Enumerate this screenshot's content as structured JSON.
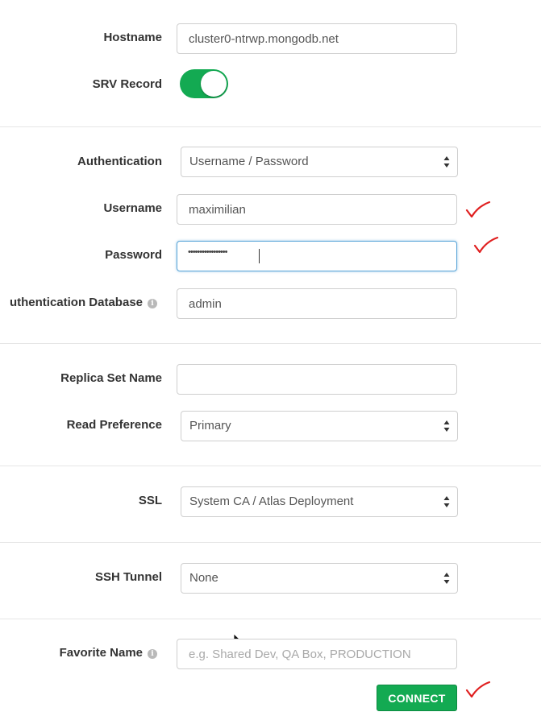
{
  "hostname": {
    "label": "Hostname",
    "value": "cluster0-ntrwp.mongodb.net"
  },
  "srv_record": {
    "label": "SRV Record",
    "enabled": true
  },
  "authentication": {
    "label": "Authentication",
    "selected": "Username / Password"
  },
  "username": {
    "label": "Username",
    "value": "maximilian"
  },
  "password": {
    "label": "Password",
    "masked_value": "•••••••••••••••••"
  },
  "auth_database": {
    "label": "uthentication Database",
    "value": "admin",
    "info_icon": "info-icon"
  },
  "replica_set": {
    "label": "Replica Set Name",
    "value": ""
  },
  "read_preference": {
    "label": "Read Preference",
    "selected": "Primary"
  },
  "ssl": {
    "label": "SSL",
    "selected": "System CA / Atlas Deployment"
  },
  "ssh_tunnel": {
    "label": "SSH Tunnel",
    "selected": "None"
  },
  "favorite_name": {
    "label": "Favorite Name",
    "placeholder": "e.g. Shared Dev, QA Box, PRODUCTION",
    "info_icon": "info-icon"
  },
  "connect_button": {
    "label": "CONNECT"
  },
  "colors": {
    "accent_green": "#13aa52",
    "focus_blue": "#5aa5d8",
    "annotation_red": "#e02020"
  }
}
